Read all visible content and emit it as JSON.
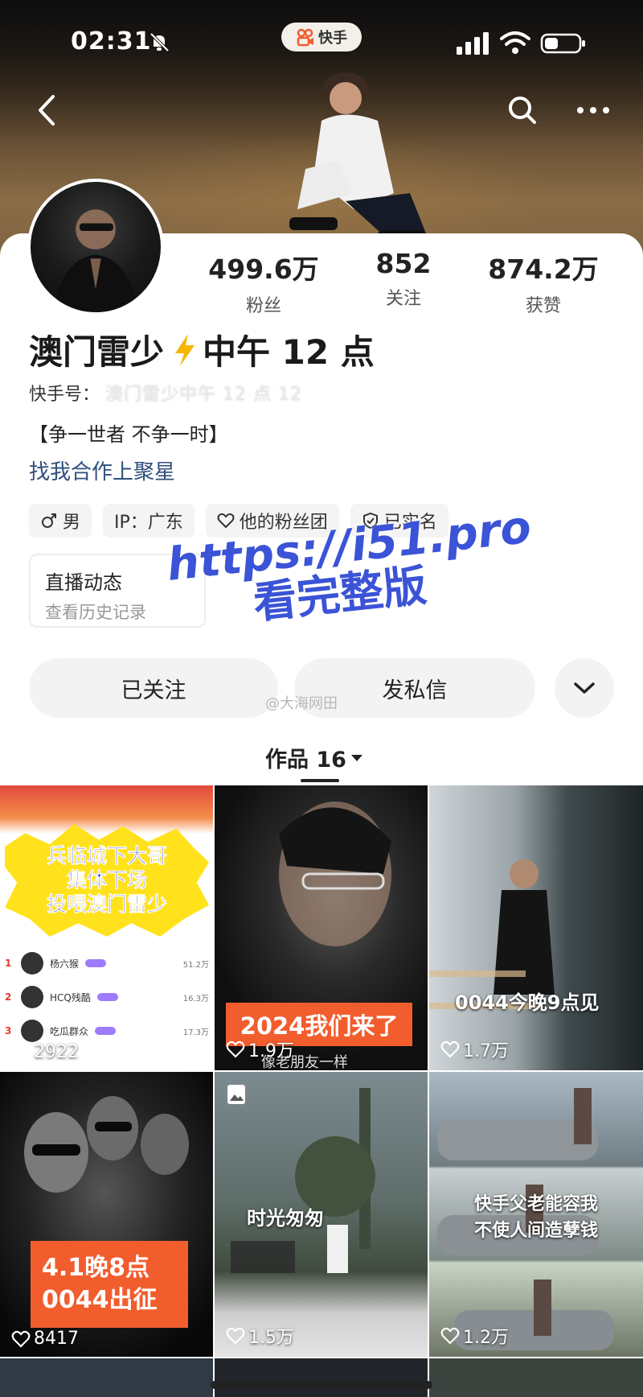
{
  "status_bar": {
    "time": "02:31",
    "app_name": "快手"
  },
  "profile": {
    "stats": [
      {
        "value": "499.6万",
        "label": "粉丝"
      },
      {
        "value": "852",
        "label": "关注"
      },
      {
        "value": "874.2万",
        "label": "获赞"
      }
    ],
    "name_part1": "澳门雷少",
    "name_part2": "中午 12 点",
    "id_label": "快手号：",
    "id_value": "澳门雷少中午 12 点 12",
    "bio": "【争一世者 不争一时】",
    "coop_link": "找我合作上聚星",
    "tags": [
      {
        "icon": "male-icon",
        "text": "男"
      },
      {
        "icon": "",
        "text": "IP：广东"
      },
      {
        "icon": "heart-outline-icon",
        "text": "他的粉丝团"
      },
      {
        "icon": "shield-check-icon",
        "text": "已实名"
      }
    ],
    "live_card": {
      "title": "直播动态",
      "subtitle": "查看历史记录"
    }
  },
  "watermark": {
    "line1": "https://i51.pro",
    "line2": "看完整版"
  },
  "actions": {
    "followed_label": "已关注",
    "message_label": "发私信",
    "weibo_mark": "@大海网田"
  },
  "works_tab": {
    "label": "作品 16"
  },
  "grid": [
    {
      "likes": "2922",
      "burst_lines": [
        "兵临城下大哥",
        "集体下场",
        "投喂澳门雷少"
      ],
      "rows": [
        {
          "rank": "1",
          "name": "杨六猴",
          "value": "51.2万"
        },
        {
          "rank": "2",
          "name": "HCQ残酷",
          "value": "16.3万"
        },
        {
          "rank": "3",
          "name": "吃瓜群众",
          "value": "17.3万"
        }
      ]
    },
    {
      "likes": "1.9万",
      "caption": "2024我们来了",
      "subcaption": "像老朋友一样"
    },
    {
      "likes": "1.7万",
      "caption": "0044今晚9点见"
    },
    {
      "likes": "8417",
      "caption_lines": [
        "4.1晚8点",
        "0044出征"
      ]
    },
    {
      "likes": "1.5万",
      "caption": "时光匆匆"
    },
    {
      "likes": "1.2万",
      "caption_lines": [
        "快手父老能容我",
        "不使人间造孽钱"
      ]
    }
  ],
  "colors": {
    "accent_orange": "#f25d2e",
    "link_blue": "#2f4f7c",
    "watermark_blue": "#3b53d6",
    "bolt_yellow": "#f7b500"
  }
}
